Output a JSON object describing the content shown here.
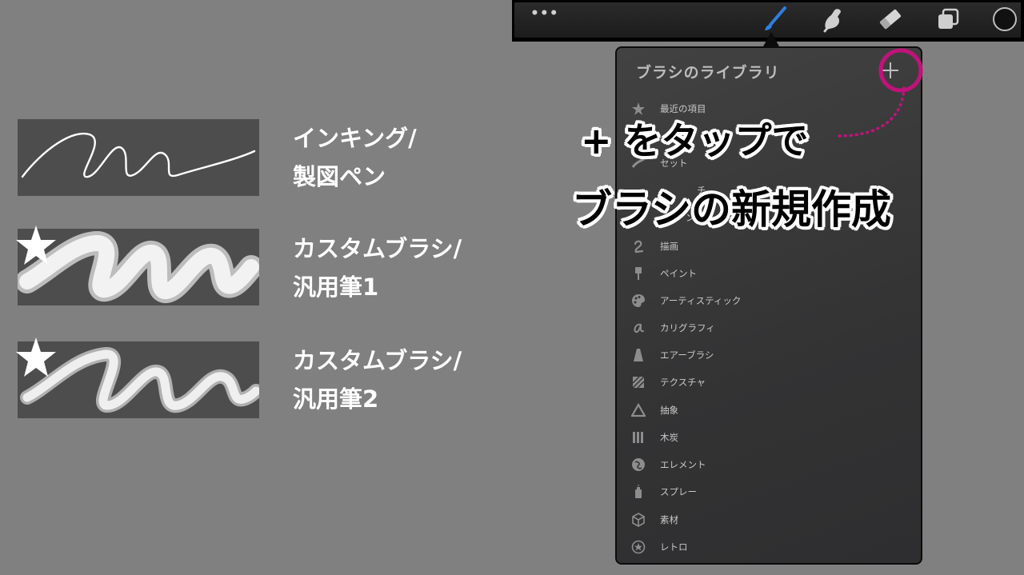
{
  "samples": [
    {
      "line1": "インキング/",
      "line2": "製図ペン",
      "starred": false
    },
    {
      "line1": "カスタムブラシ/",
      "line2": "汎用筆1",
      "starred": true
    },
    {
      "line1": "カスタムブラシ/",
      "line2": "汎用筆2",
      "starred": true
    }
  ],
  "toolbar": {
    "more": "•••",
    "icons": [
      "brush-icon",
      "smudge-icon",
      "eraser-icon",
      "layers-icon",
      "color-icon"
    ],
    "active_color": "#2f7fe0"
  },
  "panel": {
    "title": "ブラシのライブラリ",
    "add": "+",
    "items": [
      {
        "label": "最近の項目",
        "icon": "star-icon"
      },
      {
        "label": "",
        "icon": "hidden-icon"
      },
      {
        "label": "セット",
        "icon": "set-icon"
      },
      {
        "label": "チ",
        "icon": "sketch-icon"
      },
      {
        "label": "ング",
        "icon": "inking-icon"
      },
      {
        "label": "描画",
        "icon": "drawing-icon"
      },
      {
        "label": "ペイント",
        "icon": "paint-icon"
      },
      {
        "label": "アーティスティック",
        "icon": "palette-icon"
      },
      {
        "label": "カリグラフィ",
        "icon": "calligraphy-icon"
      },
      {
        "label": "エアーブラシ",
        "icon": "airbrush-icon"
      },
      {
        "label": "テクスチャ",
        "icon": "texture-icon"
      },
      {
        "label": "抽象",
        "icon": "abstract-icon"
      },
      {
        "label": "木炭",
        "icon": "charcoal-icon"
      },
      {
        "label": "エレメント",
        "icon": "element-icon"
      },
      {
        "label": "スプレー",
        "icon": "spray-icon"
      },
      {
        "label": "素材",
        "icon": "material-icon"
      },
      {
        "label": "レトロ",
        "icon": "retro-icon"
      }
    ]
  },
  "callout": {
    "line1": "+ をタップで",
    "line2": "ブラシの新規作成",
    "highlight_color": "#c0137a"
  }
}
